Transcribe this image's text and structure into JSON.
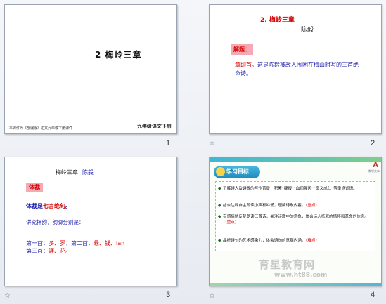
{
  "slides": [
    {
      "number": "1",
      "title": "2  梅岭三章",
      "footer_left": "本课件为《部编版》语文九年级下册课件",
      "footer_right": "九年级语文下册"
    },
    {
      "number": "2",
      "title": "2.  梅岭三章",
      "author": "陈毅",
      "label": "解题：",
      "body_red": "章即首",
      "body_blue": "。这是陈毅被敌人围困在梅山时写的三首绝命诗。"
    },
    {
      "number": "3",
      "heading_title": "梅岭三章",
      "heading_author": "陈毅",
      "label": "体裁",
      "line1_prefix": "体裁是",
      "line1_highlight": "七言绝句",
      "line1_suffix": "。",
      "line2": "讲究押韵，韵脚分别是：",
      "line3_a": "第一首：",
      "line3_b": "多、罗",
      "line3_c": "；第二首：",
      "line3_d": "悬、钱、ian",
      "line4_a": "第三首：",
      "line4_b": "涯、花",
      "line4_c": "。"
    },
    {
      "number": "4",
      "badge": "学习目标",
      "logo": "A",
      "logo_sub": "教学文本",
      "items": [
        {
          "text": "了解诗人及诗歌的写作背景，积累“捷报”“血雨腥风”“取义成仁”等重点词语。",
          "tag": ""
        },
        {
          "text": "结合注释自主朗读小声和吟诵，理解诗歌内容。",
          "tag": "（重点）"
        },
        {
          "text": "有感情地反复朗读三首诗，关注诗歌中的意象，体会诗人抵死的情怀和革命的信念。",
          "tag": "（重点）"
        },
        {
          "text": "品析诗句的艺术感染力，体会诗句的意蕴内涵。",
          "tag": "（难点）"
        }
      ],
      "watermark": "育星教育网",
      "url": "www.ht88.com"
    }
  ],
  "star_icon": "☆"
}
